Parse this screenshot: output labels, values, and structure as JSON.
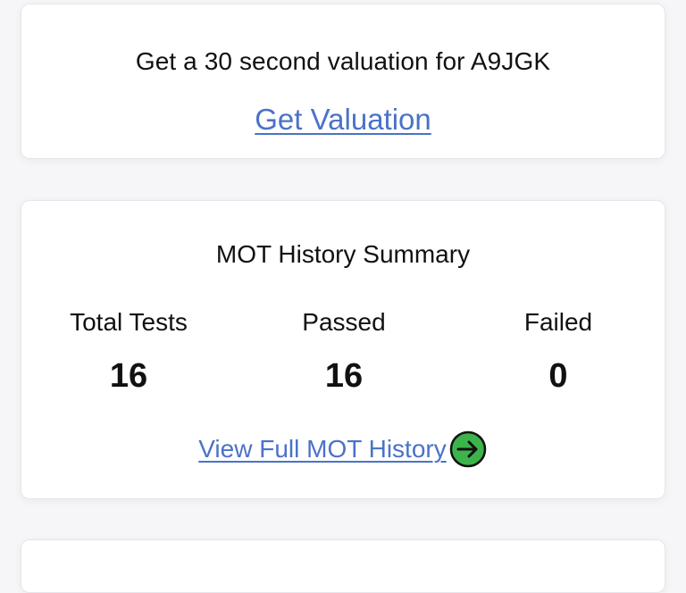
{
  "valuation": {
    "heading": "Get a 30 second valuation for A9JGK",
    "link_label": "Get Valuation"
  },
  "mot_summary": {
    "title": "MOT History Summary",
    "stats": {
      "total": {
        "label": "Total Tests",
        "value": "16"
      },
      "passed": {
        "label": "Passed",
        "value": "16"
      },
      "failed": {
        "label": "Failed",
        "value": "0"
      }
    },
    "history_link_label": "View Full MOT History",
    "history_link_icon": "arrow-right-circle-icon"
  },
  "colors": {
    "link": "#4a72c9",
    "icon_fill": "#3cb44b",
    "page_background": "#f6f6f8",
    "card_background": "#ffffff"
  }
}
